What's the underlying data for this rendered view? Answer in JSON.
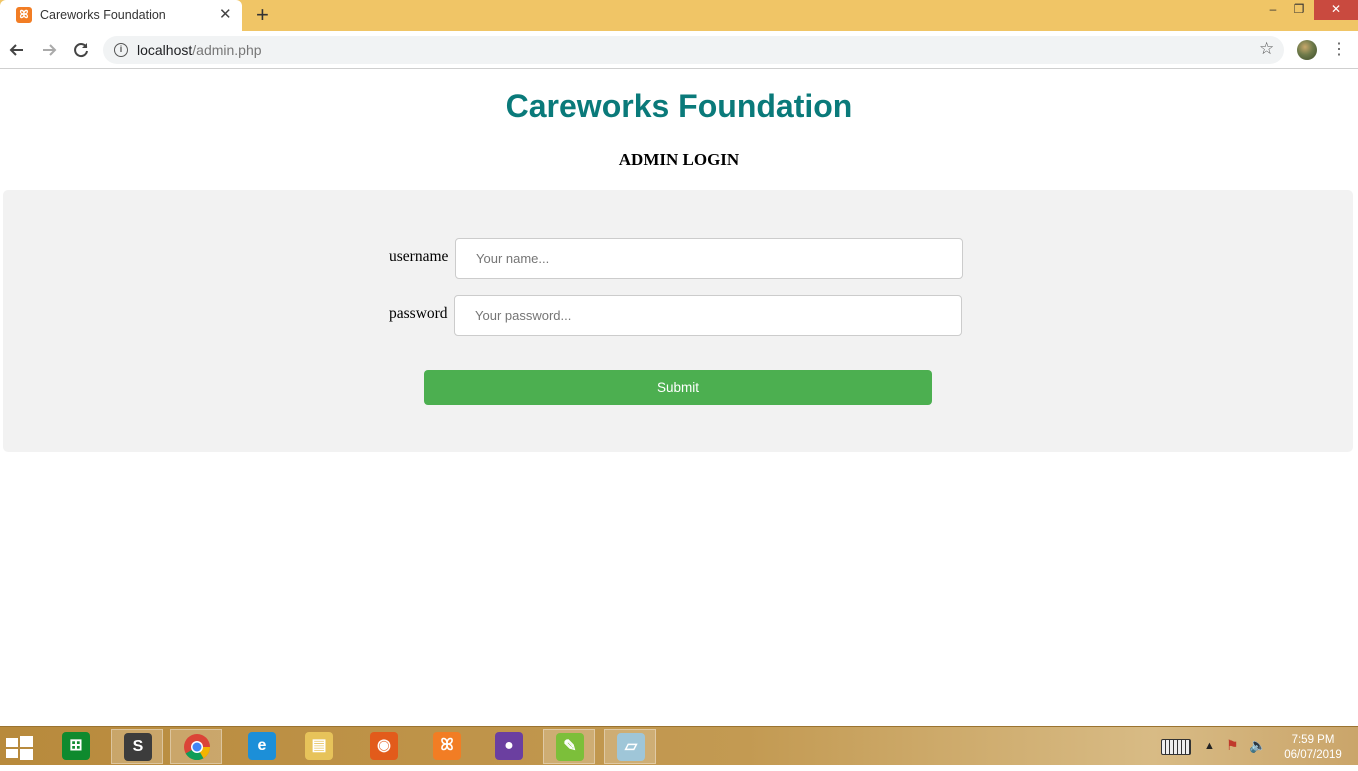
{
  "browser": {
    "tab_title": "Careworks Foundation",
    "tab_close": "✕",
    "new_tab": "+",
    "url_host": "localhost",
    "url_path": "/admin.php",
    "window_controls": {
      "minimize": "–",
      "maximize": "❐",
      "close": "✕"
    }
  },
  "page": {
    "title": "Careworks Foundation",
    "subtitle": "ADMIN LOGIN",
    "title_color": "#0a7a7a"
  },
  "form": {
    "username_label": "username",
    "username_placeholder": "Your name...",
    "username_value": "",
    "password_label": "password",
    "password_placeholder": "Your password...",
    "password_value": "",
    "submit_label": "Submit",
    "submit_color": "#4caf50"
  },
  "taskbar": {
    "apps": [
      {
        "name": "store-app-icon",
        "active": false,
        "color": "#0f8a2e",
        "glyph": "⊞"
      },
      {
        "name": "sublime-text-app-icon",
        "active": true,
        "color": "#3c3c3c",
        "glyph": "S"
      },
      {
        "name": "chrome-app-icon",
        "active": true,
        "color": "#e8e8e8",
        "glyph": ""
      },
      {
        "name": "internet-explorer-app-icon",
        "active": false,
        "color": "#1c8fd8",
        "glyph": "e"
      },
      {
        "name": "file-explorer-app-icon",
        "active": false,
        "color": "#e7c35a",
        "glyph": "▤"
      },
      {
        "name": "firefox-app-icon",
        "active": false,
        "color": "#e25b1b",
        "glyph": "◉"
      },
      {
        "name": "xampp-app-icon",
        "active": false,
        "color": "#f27d24",
        "glyph": "ꕤ"
      },
      {
        "name": "github-desktop-app-icon",
        "active": false,
        "color": "#6b3fa0",
        "glyph": "●"
      },
      {
        "name": "notepad-plus-app-icon",
        "active": true,
        "color": "#7cbf3a",
        "glyph": "✎"
      },
      {
        "name": "notes-app-icon",
        "active": true,
        "color": "#9fc6d8",
        "glyph": "▱"
      }
    ],
    "clock_time": "7:59 PM",
    "clock_date": "06/07/2019"
  }
}
